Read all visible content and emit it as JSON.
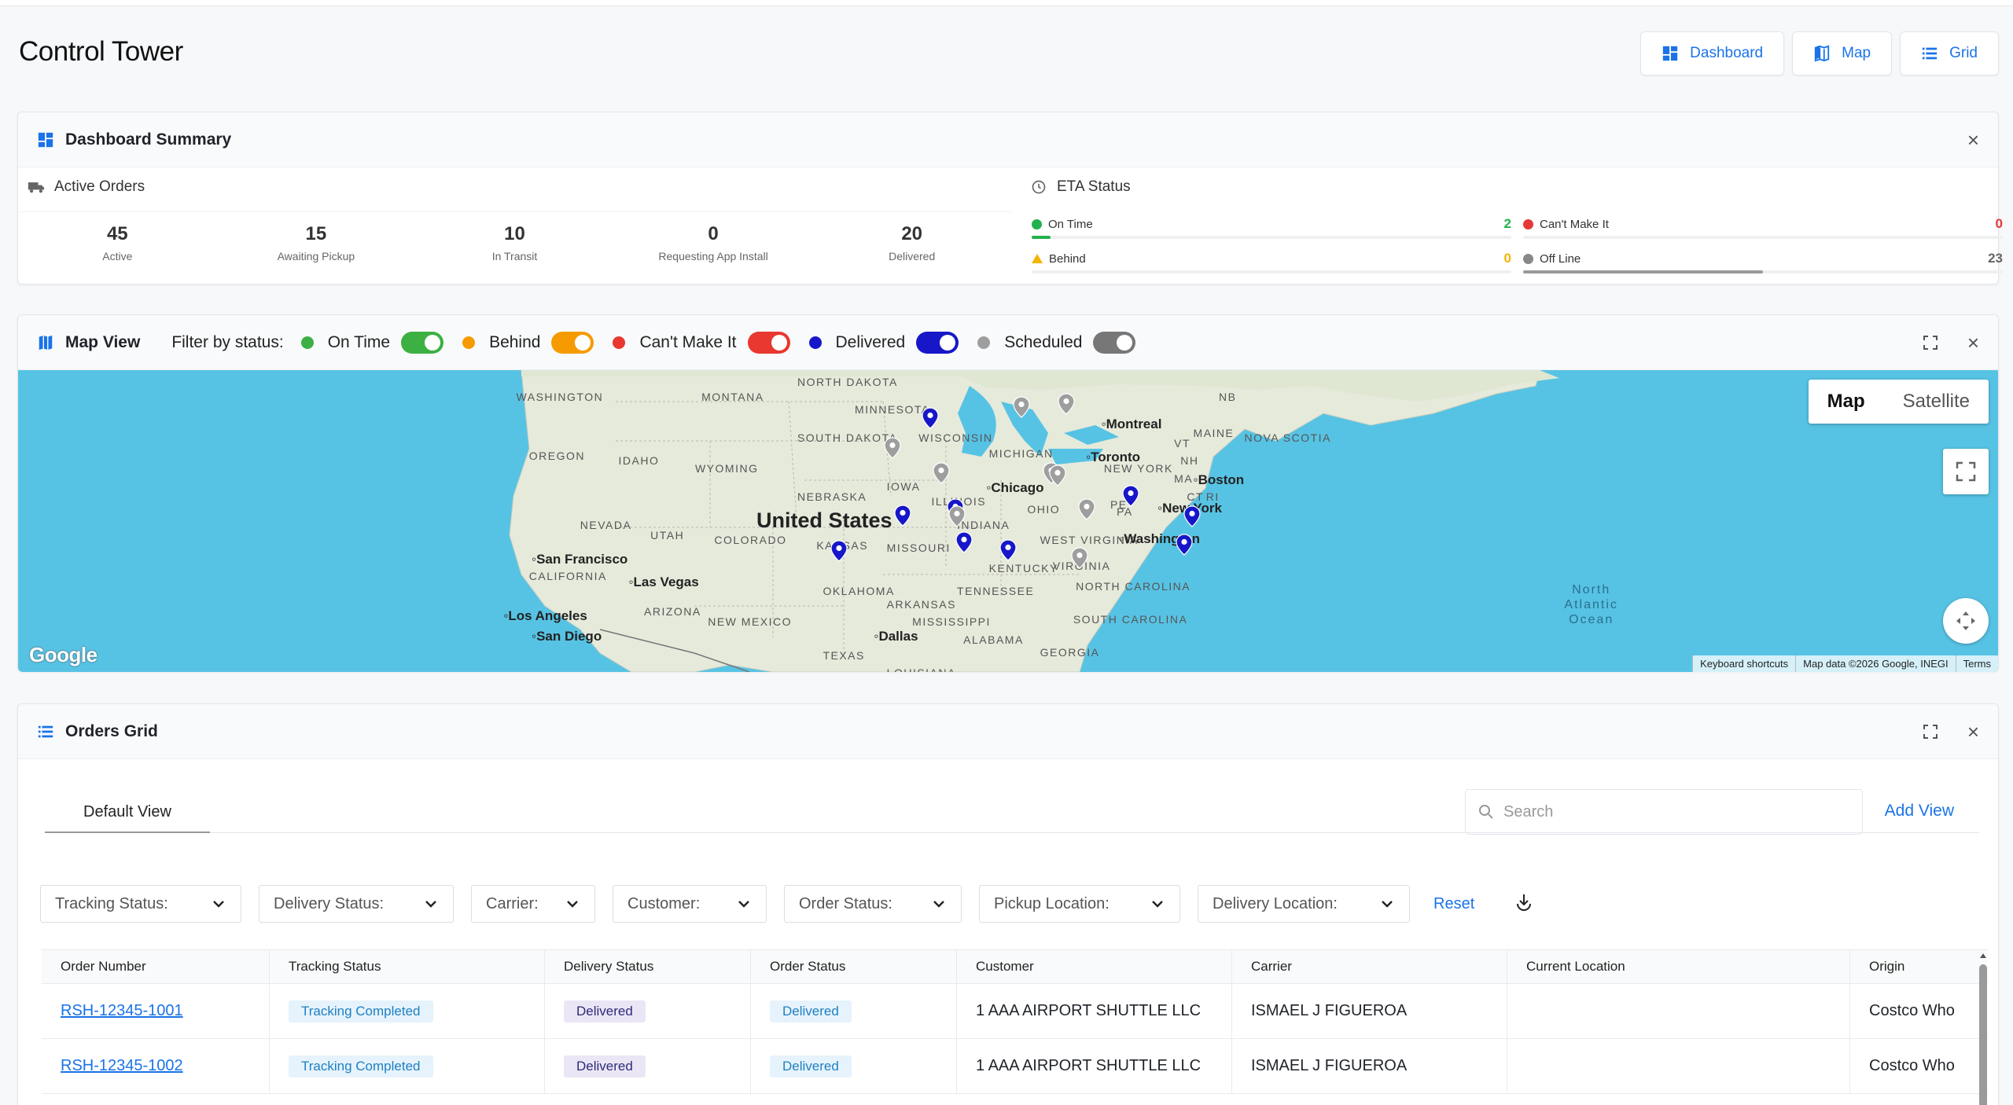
{
  "header": {
    "title": "Control Tower"
  },
  "view_buttons": [
    {
      "label": "Dashboard",
      "icon": "dashboard-icon"
    },
    {
      "label": "Map",
      "icon": "map-icon"
    },
    {
      "label": "Grid",
      "icon": "list-icon"
    }
  ],
  "summary": {
    "title": "Dashboard Summary",
    "active_orders": {
      "title": "Active Orders",
      "stats": [
        {
          "value": "45",
          "label": "Active"
        },
        {
          "value": "15",
          "label": "Awaiting Pickup"
        },
        {
          "value": "10",
          "label": "In Transit"
        },
        {
          "value": "0",
          "label": "Requesting App Install"
        },
        {
          "value": "20",
          "label": "Delivered"
        }
      ]
    },
    "eta_status": {
      "title": "ETA Status",
      "items": [
        {
          "label": "On Time",
          "value": "2",
          "color": "#22b14c",
          "fill_fraction": 0.04
        },
        {
          "label": "Can't Make It",
          "value": "0",
          "color": "#e53935",
          "fill_fraction": 0
        },
        {
          "label": "Behind",
          "value": "0",
          "color": "#f5b400",
          "fill_fraction": 0
        },
        {
          "label": "Off Line",
          "value": "23",
          "color": "#888888",
          "fill_fraction": 0.5
        }
      ]
    }
  },
  "map_view": {
    "title": "Map View",
    "filter_label": "Filter by status:",
    "filters": [
      {
        "label": "On Time",
        "dot": "#3cb043",
        "toggle": "#3cb043"
      },
      {
        "label": "Behind",
        "dot": "#f59b00",
        "toggle": "#f59b00"
      },
      {
        "label": "Can't Make It",
        "dot": "#e8382f",
        "toggle": "#e8382f"
      },
      {
        "label": "Delivered",
        "dot": "#1717c9",
        "toggle": "#1717c9"
      },
      {
        "label": "Scheduled",
        "dot": "#9e9e9e",
        "toggle": "#777777"
      }
    ],
    "map_type": {
      "map": "Map",
      "satellite": "Satellite"
    },
    "labels": {
      "country": "United States",
      "ocean": "North Atlantic Ocean",
      "states": [
        "WASHINGTON",
        "MONTANA",
        "NORTH DAKOTA",
        "MINNESOTA",
        "SOUTH DAKOTA",
        "WISCONSIN",
        "MICHIGAN",
        "OREGON",
        "IDAHO",
        "WYOMING",
        "NEBRASKA",
        "IOWA",
        "ILLINOIS",
        "NEVADA",
        "UTAH",
        "COLORADO",
        "KANSAS",
        "MISSOURI",
        "INDIANA",
        "OHIO",
        "CALIFORNIA",
        "ARIZONA",
        "NEW MEXICO",
        "OKLAHOMA",
        "ARKANSAS",
        "TENNESSEE",
        "KENTUCKY",
        "WEST VIRGINIA",
        "VIRGINIA",
        "NORTH CAROLINA",
        "SOUTH CAROLINA",
        "MISSISSIPPI",
        "ALABAMA",
        "GEORGIA",
        "TEXAS",
        "LOUISIANA",
        "MAINE",
        "NOVA SCOTIA",
        "NEW YORK",
        "VT",
        "NH",
        "MA",
        "CT",
        "RI",
        "PE",
        "NB",
        "PA"
      ],
      "cities": [
        "Montreal",
        "Toronto",
        "Boston",
        "Chicago",
        "New York",
        "Washington",
        "San Francisco",
        "Las Vegas",
        "Los Angeles",
        "San Diego",
        "Dallas"
      ]
    },
    "google_logo": "Google",
    "attribution": [
      "Keyboard shortcuts",
      "Map data ©2026 Google, INEGI",
      "Terms"
    ]
  },
  "orders": {
    "title": "Orders Grid",
    "tab": "Default View",
    "search_placeholder": "Search",
    "add_view": "Add View",
    "reset": "Reset",
    "filters": [
      "Tracking Status:",
      "Delivery Status:",
      "Carrier:",
      "Customer:",
      "Order Status:",
      "Pickup Location:",
      "Delivery Location:"
    ],
    "columns": [
      "Order Number",
      "Tracking Status",
      "Delivery Status",
      "Order Status",
      "Customer",
      "Carrier",
      "Current Location",
      "Origin"
    ],
    "rows": [
      {
        "order_number": "RSH-12345-1001",
        "tracking": "Tracking Completed",
        "delivery": "Delivered",
        "order_status": "Delivered",
        "customer": "1 AAA AIRPORT SHUTTLE LLC",
        "carrier": "ISMAEL J FIGUEROA",
        "location": "",
        "origin": "Costco Who"
      },
      {
        "order_number": "RSH-12345-1002",
        "tracking": "Tracking Completed",
        "delivery": "Delivered",
        "order_status": "Delivered",
        "customer": "1 AAA AIRPORT SHUTTLE LLC",
        "carrier": "ISMAEL J FIGUEROA",
        "location": "",
        "origin": "Costco Who"
      }
    ]
  },
  "colors": {
    "accent": "#1a73e8",
    "water": "#57c3e4",
    "land": "#e6eadb",
    "pin_scheduled": "#9e9e9e",
    "pin_delivered": "#1717c9"
  }
}
